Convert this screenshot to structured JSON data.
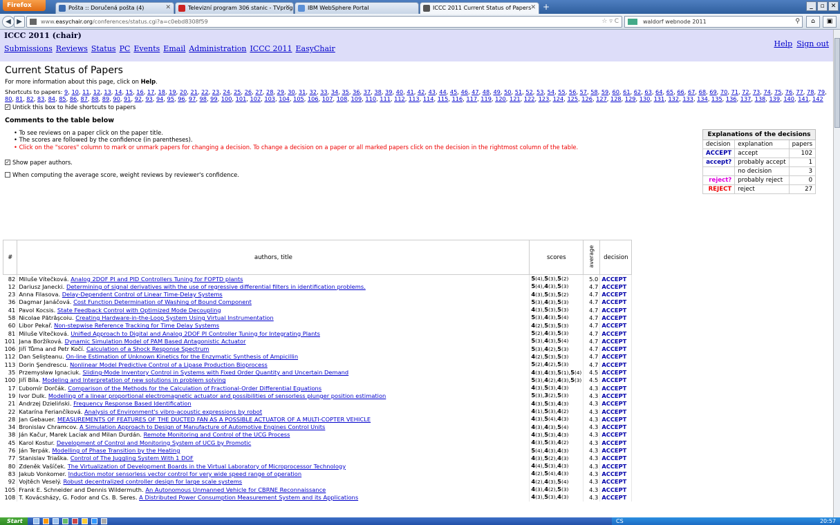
{
  "browser": {
    "menu_button": "Firefox",
    "tabs": [
      {
        "title": "Pošta :: Doručená pošta (4)",
        "active": false
      },
      {
        "title": "Televizní program 306 stanic - TVprogram...",
        "active": false
      },
      {
        "title": "IBM WebSphere Portal",
        "active": false
      },
      {
        "title": "ICCC 2011 Current Status of Papers",
        "active": true
      }
    ],
    "url_prefix": "www.",
    "url_domain": "easychair.org",
    "url_path": "/conferences/status.cgi?a=c0ebd8308f59",
    "search_text": "waldorf webnode 2011"
  },
  "header": {
    "conf_title": "ICCC 2011 (chair)",
    "menu": [
      "Submissions",
      "Reviews",
      "Status",
      "PC",
      "Events",
      "Email",
      "Administration",
      "ICCC 2011",
      "EasyChair"
    ],
    "help": "Help",
    "signout": "Sign out"
  },
  "page": {
    "title": "Current Status of Papers",
    "info_prefix": "For more information about this page, click on ",
    "info_link": "Help",
    "info_suffix": ".",
    "shortcuts_label": "Shortcuts to papers:",
    "shortcuts": [
      9,
      10,
      11,
      12,
      13,
      14,
      15,
      16,
      17,
      18,
      19,
      20,
      21,
      22,
      23,
      24,
      25,
      26,
      27,
      28,
      29,
      30,
      31,
      32,
      33,
      34,
      35,
      36,
      37,
      38,
      39,
      40,
      41,
      42,
      43,
      44,
      45,
      46,
      47,
      48,
      49,
      50,
      51,
      52,
      53,
      54,
      55,
      56,
      57,
      58,
      59,
      60,
      61,
      62,
      63,
      64,
      65,
      66,
      67,
      68,
      69,
      70,
      71,
      72,
      73,
      74,
      75,
      76,
      77,
      78,
      79,
      80,
      81,
      82,
      83,
      84,
      85,
      86,
      87,
      88,
      89,
      90,
      91,
      92,
      93,
      94,
      95,
      96,
      97,
      98,
      99,
      100,
      101,
      102,
      103,
      104,
      105,
      106,
      107,
      108,
      109,
      110,
      111,
      112,
      113,
      114,
      115,
      116,
      117,
      119,
      120,
      121,
      122,
      123,
      124,
      125,
      126,
      127,
      128,
      129,
      130,
      131,
      132,
      133,
      134,
      135,
      136,
      137,
      138,
      139,
      140,
      141,
      142
    ],
    "untick_label": "Untick this box to hide shortcuts to papers",
    "comments_heading": "Comments to the table below",
    "comments": [
      "To see reviews on a paper click on the paper title.",
      "The scores are followed by the confidence (in parentheses)."
    ],
    "comment_red": "Click on the \"scores\" column to mark or unmark papers for changing a decision. To change a decision on a paper or all marked papers click on the decision in the rightmost column of the table.",
    "show_authors_label": "Show paper authors.",
    "weight_label": "When computing the average score, weight reviews by reviewer's confidence."
  },
  "explanations": {
    "heading": "Explanations of the decisions",
    "col_decision": "decision",
    "col_explanation": "explanation",
    "col_papers": "papers",
    "rows": [
      {
        "decision": "ACCEPT",
        "explanation": "accept",
        "papers": "102",
        "color": "#0000aa"
      },
      {
        "decision": "accept?",
        "explanation": "probably accept",
        "papers": "1",
        "color": "#0000aa"
      },
      {
        "decision": "",
        "explanation": "no decision",
        "papers": "3",
        "color": "#000000"
      },
      {
        "decision": "reject?",
        "explanation": "probably reject",
        "papers": "0",
        "color": "#dd00dd"
      },
      {
        "decision": "REJECT",
        "explanation": "reject",
        "papers": "27",
        "color": "#ee0000"
      }
    ]
  },
  "table": {
    "col_num": "#",
    "col_title": "authors, title",
    "col_scores": "scores",
    "col_avg": "average",
    "col_decision": "decision",
    "rows": [
      {
        "num": "82",
        "authors": "Miluše Vítečková.",
        "title": "Analog 2DOF PI and PID Controllers Tuning for FOPTD plants",
        "scores": "5(4),5(3),5(2)",
        "avg": "5.0",
        "decision": "ACCEPT"
      },
      {
        "num": "12",
        "authors": "Dariusz Janecki.",
        "title": "Determining of signal derivatives with the use of regressive differential filters in identification problems.",
        "scores": "5(4),4(3),5(3)",
        "avg": "4.7",
        "decision": "ACCEPT"
      },
      {
        "num": "23",
        "authors": "Anna Filasova.",
        "title": "Delay-Dependent Control of Linear Time-Delay Systems",
        "scores": "4(3),5(3),5(2)",
        "avg": "4.7",
        "decision": "ACCEPT"
      },
      {
        "num": "36",
        "authors": "Dagmar Janáčová.",
        "title": "Cost Function Determination of Washing of Bound Component",
        "scores": "5(3),4(3),5(3)",
        "avg": "4.7",
        "decision": "ACCEPT"
      },
      {
        "num": "41",
        "authors": "Pavol Kocsis.",
        "title": "State Feedback Control with Optimized Mode Decoupling",
        "scores": "4(3),5(3),5(3)",
        "avg": "4.7",
        "decision": "ACCEPT"
      },
      {
        "num": "58",
        "authors": "Nicolae Pătrăşcoiu.",
        "title": "Creating Hardware-in-the-Loop System Using Virtual Instrumentation",
        "scores": "5(3),4(3),5(4)",
        "avg": "4.7",
        "decision": "ACCEPT"
      },
      {
        "num": "60",
        "authors": "Libor Pekař.",
        "title": "Non-stepwise Reference Tracking for Time Delay Systems",
        "scores": "4(2),5(3),5(3)",
        "avg": "4.7",
        "decision": "ACCEPT"
      },
      {
        "num": "81",
        "authors": "Miluše Vítečková.",
        "title": "Unified Approach to Digital and Analog 2DOF PI Controller Tuning for Integrating Plants",
        "scores": "5(2),4(3),5(3)",
        "avg": "4.7",
        "decision": "ACCEPT"
      },
      {
        "num": "101",
        "authors": "Jana Boržíková.",
        "title": "Dynamic Simulation Model of PAM Based Antagonistic Actuator",
        "scores": "5(3),4(3),5(4)",
        "avg": "4.7",
        "decision": "ACCEPT"
      },
      {
        "num": "106",
        "authors": "Jiří Tůma and Petr Kočí.",
        "title": "Calculation of a Shock Response Spectrum",
        "scores": "5(3),4(2),5(3)",
        "avg": "4.7",
        "decision": "ACCEPT"
      },
      {
        "num": "112",
        "authors": "Dan Selişteanu.",
        "title": "On-line Estimation of Unknown Kinetics for the Enzymatic Synthesis of Ampicillin",
        "scores": "4(2),5(3),5(3)",
        "avg": "4.7",
        "decision": "ACCEPT"
      },
      {
        "num": "113",
        "authors": "Dorin Şendrescu.",
        "title": "Nonlinear Model Predictive Control of a Lipase Production Bioprocess",
        "scores": "5(2),4(2),5(3)",
        "avg": "4.7",
        "decision": "ACCEPT"
      },
      {
        "num": "35",
        "authors": "Przemysław Ignaciuk.",
        "title": "Sliding-Mode Inventory Control in Systems with Fixed Order Quantity and Uncertain Demand",
        "scores": "4(3),4(3),5(1),5(4)",
        "avg": "4.5",
        "decision": "ACCEPT"
      },
      {
        "num": "100",
        "authors": "Jiří Bíla.",
        "title": "Modeling and Interpretation of new solutions in problem solving",
        "scores": "5(3),4(2),4(3),5(3)",
        "avg": "4.5",
        "decision": "ACCEPT"
      },
      {
        "num": "17",
        "authors": "Ľubomír Dorčák.",
        "title": "Comparison of the Methods for the Calculation of Fractional-Order Differential Equations",
        "scores": "4(3),5(3),4(3)",
        "avg": "4.3",
        "decision": "ACCEPT"
      },
      {
        "num": "19",
        "authors": "Ivor Dulk.",
        "title": "Modelling of a linear proportional electromagnetic actuator and possibilities of sensorless plunger position estimation",
        "scores": "5(3),3(2),5(3)",
        "avg": "4.3",
        "decision": "ACCEPT"
      },
      {
        "num": "21",
        "authors": "Andrzej Dzieliński.",
        "title": "Frequency Response Based Identification",
        "scores": "4(3),5(3),4(3)",
        "avg": "4.3",
        "decision": "ACCEPT"
      },
      {
        "num": "22",
        "authors": "Katarína Feriančíková.",
        "title": "Analysis of Environment's vibro-acoustic expressions by robot",
        "scores": "4(1),5(3),4(2)",
        "avg": "4.3",
        "decision": "ACCEPT"
      },
      {
        "num": "28",
        "authors": "Jan Gebauer.",
        "title": "MEASUREMENTS OF FEATURES OF THE DUCTED FAN AS A POSSIBLE ACTUATOR OF A MULTI-COPTER VEHICLE",
        "scores": "4(3),5(4),4(3)",
        "avg": "4.3",
        "decision": "ACCEPT"
      },
      {
        "num": "34",
        "authors": "Bronislav Chramcov.",
        "title": "A Simulation Approach to Design of Manufacture of Automotive Engines Control Units",
        "scores": "4(3),4(3),5(4)",
        "avg": "4.3",
        "decision": "ACCEPT"
      },
      {
        "num": "38",
        "authors": "Ján Kačur, Marek Laciak and Milan Durdán.",
        "title": "Remote Monitoring and Control of the UCG Process",
        "scores": "4(3),5(3),4(3)",
        "avg": "4.3",
        "decision": "ACCEPT"
      },
      {
        "num": "45",
        "authors": "Karol Kostur.",
        "title": "Development of Control and Monitoring System of UCG by Promotic",
        "scores": "4(3),5(3),4(2)",
        "avg": "4.3",
        "decision": "ACCEPT"
      },
      {
        "num": "76",
        "authors": "Ján Terpák.",
        "title": "Modelling of Phase Transition by the Heating",
        "scores": "5(4),4(3),4(3)",
        "avg": "4.3",
        "decision": "ACCEPT"
      },
      {
        "num": "77",
        "authors": "Stanislav Triaška.",
        "title": "Control of The Juggling System With 1 DOF",
        "scores": "4(3),5(2),4(3)",
        "avg": "4.3",
        "decision": "ACCEPT"
      },
      {
        "num": "80",
        "authors": "Zdeněk Vašíček.",
        "title": "The Virtualization of Development Boards in the Virtual Laboratory of Microprocessor Technology",
        "scores": "4(4),5(3),4(3)",
        "avg": "4.3",
        "decision": "ACCEPT"
      },
      {
        "num": "83",
        "authors": "Jakub Vonkomer.",
        "title": "Induction motor sensorless vector control for very wide speed range of operation",
        "scores": "4(2),5(4),4(3)",
        "avg": "4.3",
        "decision": "ACCEPT"
      },
      {
        "num": "92",
        "authors": "Vojtěch Veselý.",
        "title": "Robust decentralized controller design for large scale systems",
        "scores": "4(2),4(3),5(4)",
        "avg": "4.3",
        "decision": "ACCEPT"
      },
      {
        "num": "105",
        "authors": "Frank E. Schneider and Dennis Wildermuth.",
        "title": "An Autonomous Unmanned Vehicle for CBRNE Reconnaissance",
        "scores": "4(3),4(2),5(3)",
        "avg": "4.3",
        "decision": "ACCEPT"
      },
      {
        "num": "108",
        "authors": "T. Kovácsházy, G. Fodor and Cs. B. Seres.",
        "title": "A Distributed Power Consumption Measurement System and its Applications",
        "scores": "4(3),5(3),4(3)",
        "avg": "4.3",
        "decision": "ACCEPT"
      }
    ]
  },
  "taskbar": {
    "start": "Start",
    "lang": "CS",
    "clock": "20:57"
  }
}
